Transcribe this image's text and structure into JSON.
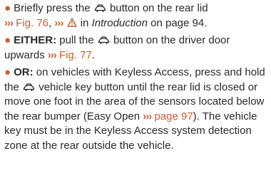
{
  "instructions": {
    "p1": {
      "text_before_icon": "Briefly press the",
      "icon": "rear-lid-icon",
      "text_after_icon": "button on the rear lid",
      "ref_arrow": "›››",
      "fig_ref": "Fig. 76",
      "sep": ",",
      "ref_arrow_2": "›››",
      "warning_icon": "warning-triangle-icon",
      "in_text": "in",
      "section_ref": "Introduction",
      "page_text": "on page 94."
    },
    "p2": {
      "lead": "EITHER:",
      "text_before_icon": "pull the",
      "icon": "rear-lid-icon",
      "text_after_icon": "button on the driver door upwards",
      "ref_arrow": "›››",
      "fig_ref": "Fig. 77",
      "end": "."
    },
    "p3": {
      "lead": "OR:",
      "text_1": "on vehicles with Keyless Access, press and hold the",
      "icon": "rear-lid-icon",
      "text_2": "vehicle key button until the rear lid is closed or move one foot in the area of the sensors located below the rear bumper (Easy Open",
      "ref_arrow": "›››",
      "page_ref": "page 97",
      "text_3": "). The vehicle key must be in the Keyless Access system detection zone at the rear outside the vehicle."
    }
  },
  "colors": {
    "accent": "#c7602f",
    "text": "#2a2a2a"
  }
}
